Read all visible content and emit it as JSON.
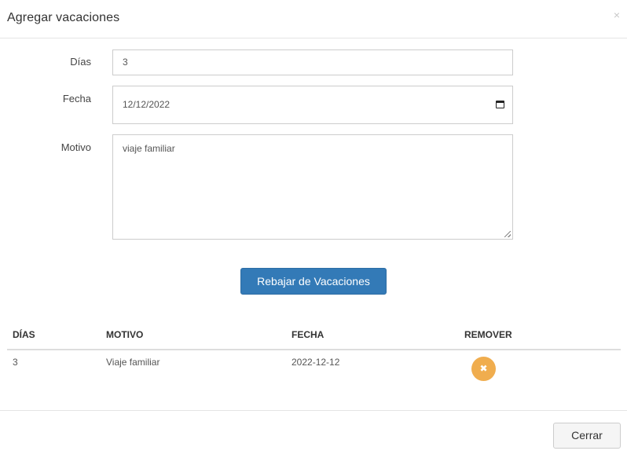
{
  "modal": {
    "title": "Agregar vacaciones",
    "close_symbol": "×"
  },
  "form": {
    "dias_label": "Días",
    "dias_value": "3",
    "fecha_label": "Fecha",
    "fecha_value": "12/12/2022",
    "motivo_label": "Motivo",
    "motivo_value": "viaje familiar"
  },
  "actions": {
    "submit_label": "Rebajar de Vacaciones"
  },
  "table": {
    "headers": [
      "DÍAS",
      "MOTIVO",
      "FECHA",
      "REMOVER"
    ],
    "rows": [
      {
        "dias": "3",
        "motivo": "Viaje familiar",
        "fecha": "2022-12-12",
        "remove_symbol": "✖"
      }
    ]
  },
  "footer": {
    "close_label": "Cerrar"
  },
  "colors": {
    "primary": "#337ab7",
    "warning": "#f0ad4e"
  },
  "icons": {
    "close": "close-icon",
    "calendar": "calendar-icon",
    "remove": "remove-icon"
  }
}
